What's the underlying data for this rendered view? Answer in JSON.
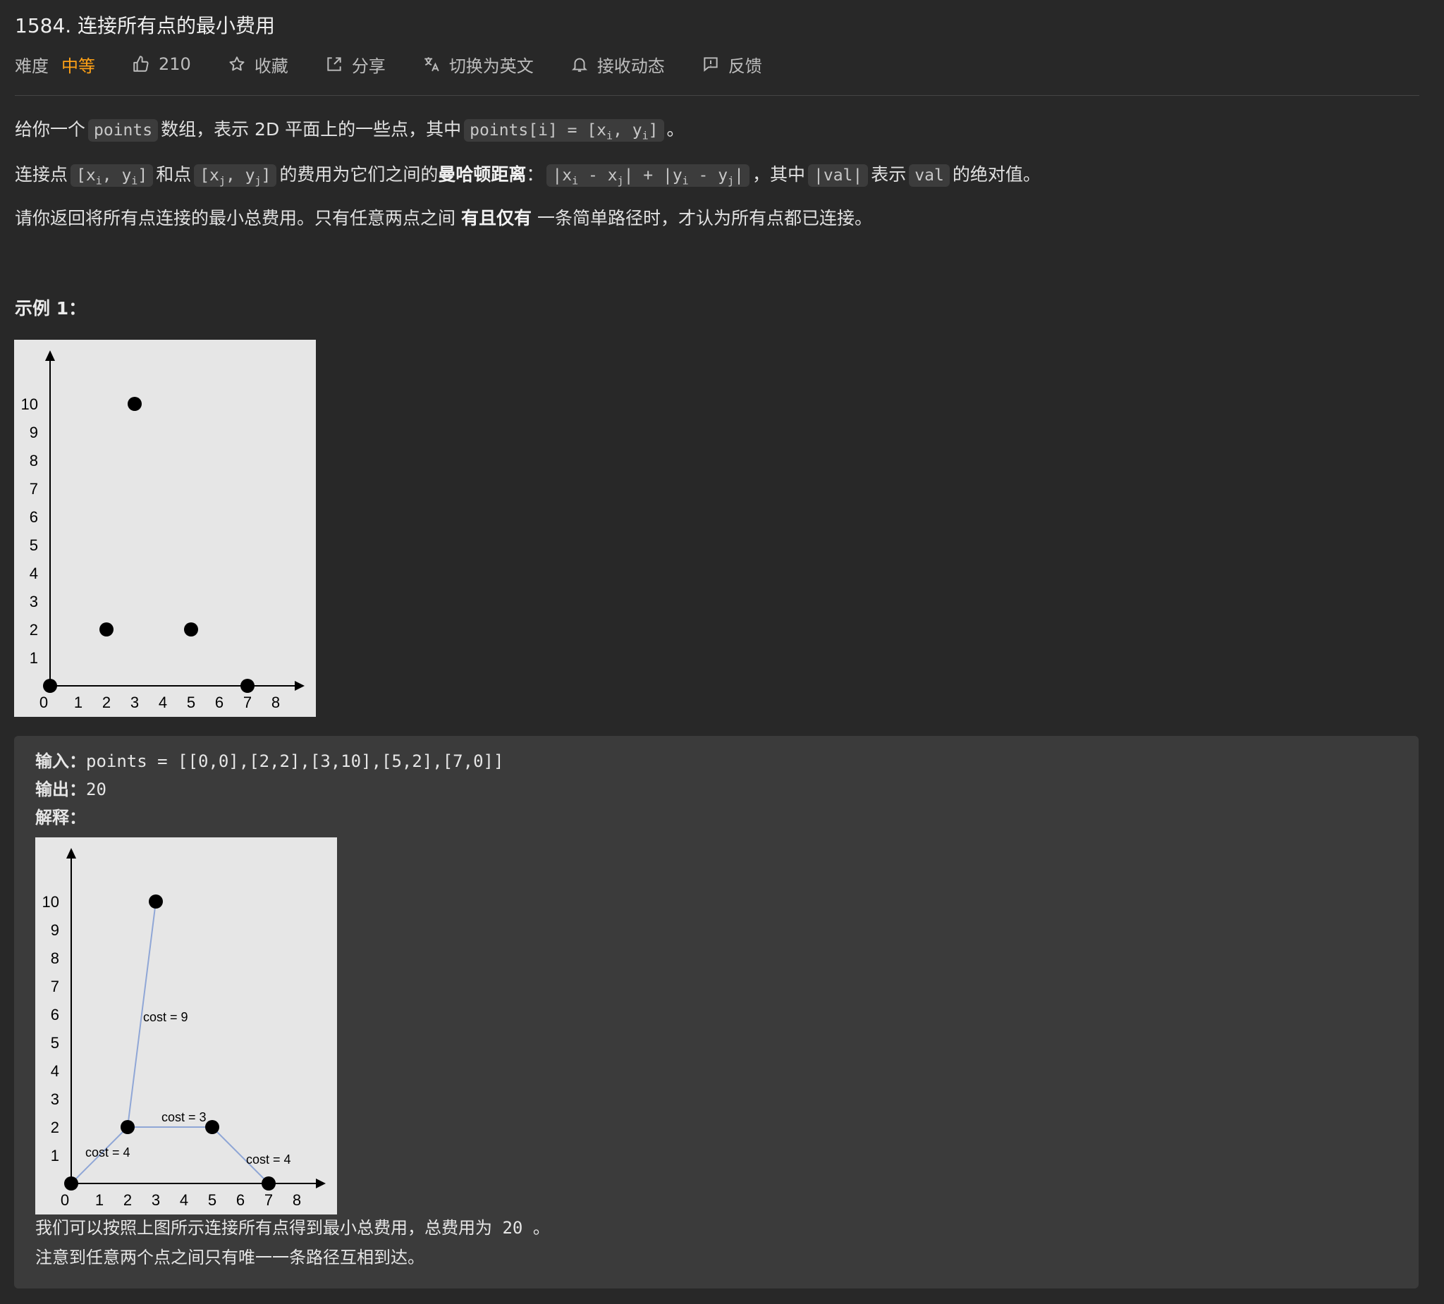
{
  "problem": {
    "title": "1584. 连接所有点的最小费用",
    "difficulty_label": "难度",
    "difficulty": "中等",
    "likes": "210",
    "favorite_label": "收藏",
    "share_label": "分享",
    "switch_lang_label": "切换为英文",
    "subscribe_label": "接收动态",
    "feedback_label": "反馈",
    "colors": {
      "difficulty": "#ffa116",
      "background": "#282828",
      "code_bg": "#3c3c3c"
    }
  },
  "description": {
    "p1_a": "给你一个",
    "p1_code1": "points",
    "p1_b": "数组，表示 2D 平面上的一些点，其中",
    "p1_code2": "points[i] = [x",
    "p1_sub_i": "i",
    "p1_code2b": ", y",
    "p1_code2c": "]",
    "p1_c": "。",
    "p2_a": "连接点",
    "p2_b": "和点",
    "p2_c": "的费用为它们之间的",
    "p2_bold": "曼哈顿距离",
    "p2_d": "：",
    "p2_e": "，其中",
    "p2_f": "表示",
    "p2_g": "的绝对值。",
    "code_val_abs": "|val|",
    "code_val": "val",
    "p3_a": "请你返回将所有点连接的最小总费用。只有任意两点之间",
    "p3_bold": "有且仅有",
    "p3_b": "一条简单路径时，才认为所有点都已连接。"
  },
  "example": {
    "title": "示例 1：",
    "input_label": "输入：",
    "input_value": "points = [[0,0],[2,2],[3,10],[5,2],[7,0]]",
    "output_label": "输出：",
    "output_value": "20",
    "explain_label": "解释：",
    "note1_a": "我们可以按照上图所示连接所有点得到最小总费用，总费用为",
    "note1_num": "20",
    "note1_b": "。",
    "note2": "注意到任意两个点之间只有唯一一条路径互相到达。"
  },
  "chart_data": [
    {
      "type": "scatter",
      "x_ticks": [
        "0",
        "1",
        "2",
        "3",
        "4",
        "5",
        "6",
        "7",
        "8"
      ],
      "y_ticks": [
        "1",
        "2",
        "3",
        "4",
        "5",
        "6",
        "7",
        "8",
        "9",
        "10"
      ],
      "xlim": [
        0,
        8
      ],
      "ylim": [
        0,
        10
      ],
      "points": [
        [
          0,
          0
        ],
        [
          2,
          2
        ],
        [
          3,
          10
        ],
        [
          5,
          2
        ],
        [
          7,
          0
        ]
      ],
      "grid": false
    },
    {
      "type": "scatter",
      "x_ticks": [
        "0",
        "1",
        "2",
        "3",
        "4",
        "5",
        "6",
        "7",
        "8"
      ],
      "y_ticks": [
        "1",
        "2",
        "3",
        "4",
        "5",
        "6",
        "7",
        "8",
        "9",
        "10"
      ],
      "xlim": [
        0,
        8
      ],
      "ylim": [
        0,
        10
      ],
      "points": [
        [
          0,
          0
        ],
        [
          2,
          2
        ],
        [
          3,
          10
        ],
        [
          5,
          2
        ],
        [
          7,
          0
        ]
      ],
      "edges": [
        {
          "from": [
            0,
            0
          ],
          "to": [
            2,
            2
          ],
          "label": "cost = 4"
        },
        {
          "from": [
            2,
            2
          ],
          "to": [
            3,
            10
          ],
          "label": "cost = 9"
        },
        {
          "from": [
            2,
            2
          ],
          "to": [
            5,
            2
          ],
          "label": "cost = 3"
        },
        {
          "from": [
            5,
            2
          ],
          "to": [
            7,
            0
          ],
          "label": "cost = 4"
        }
      ],
      "edge_color": "#8fa6d6",
      "grid": false
    }
  ]
}
